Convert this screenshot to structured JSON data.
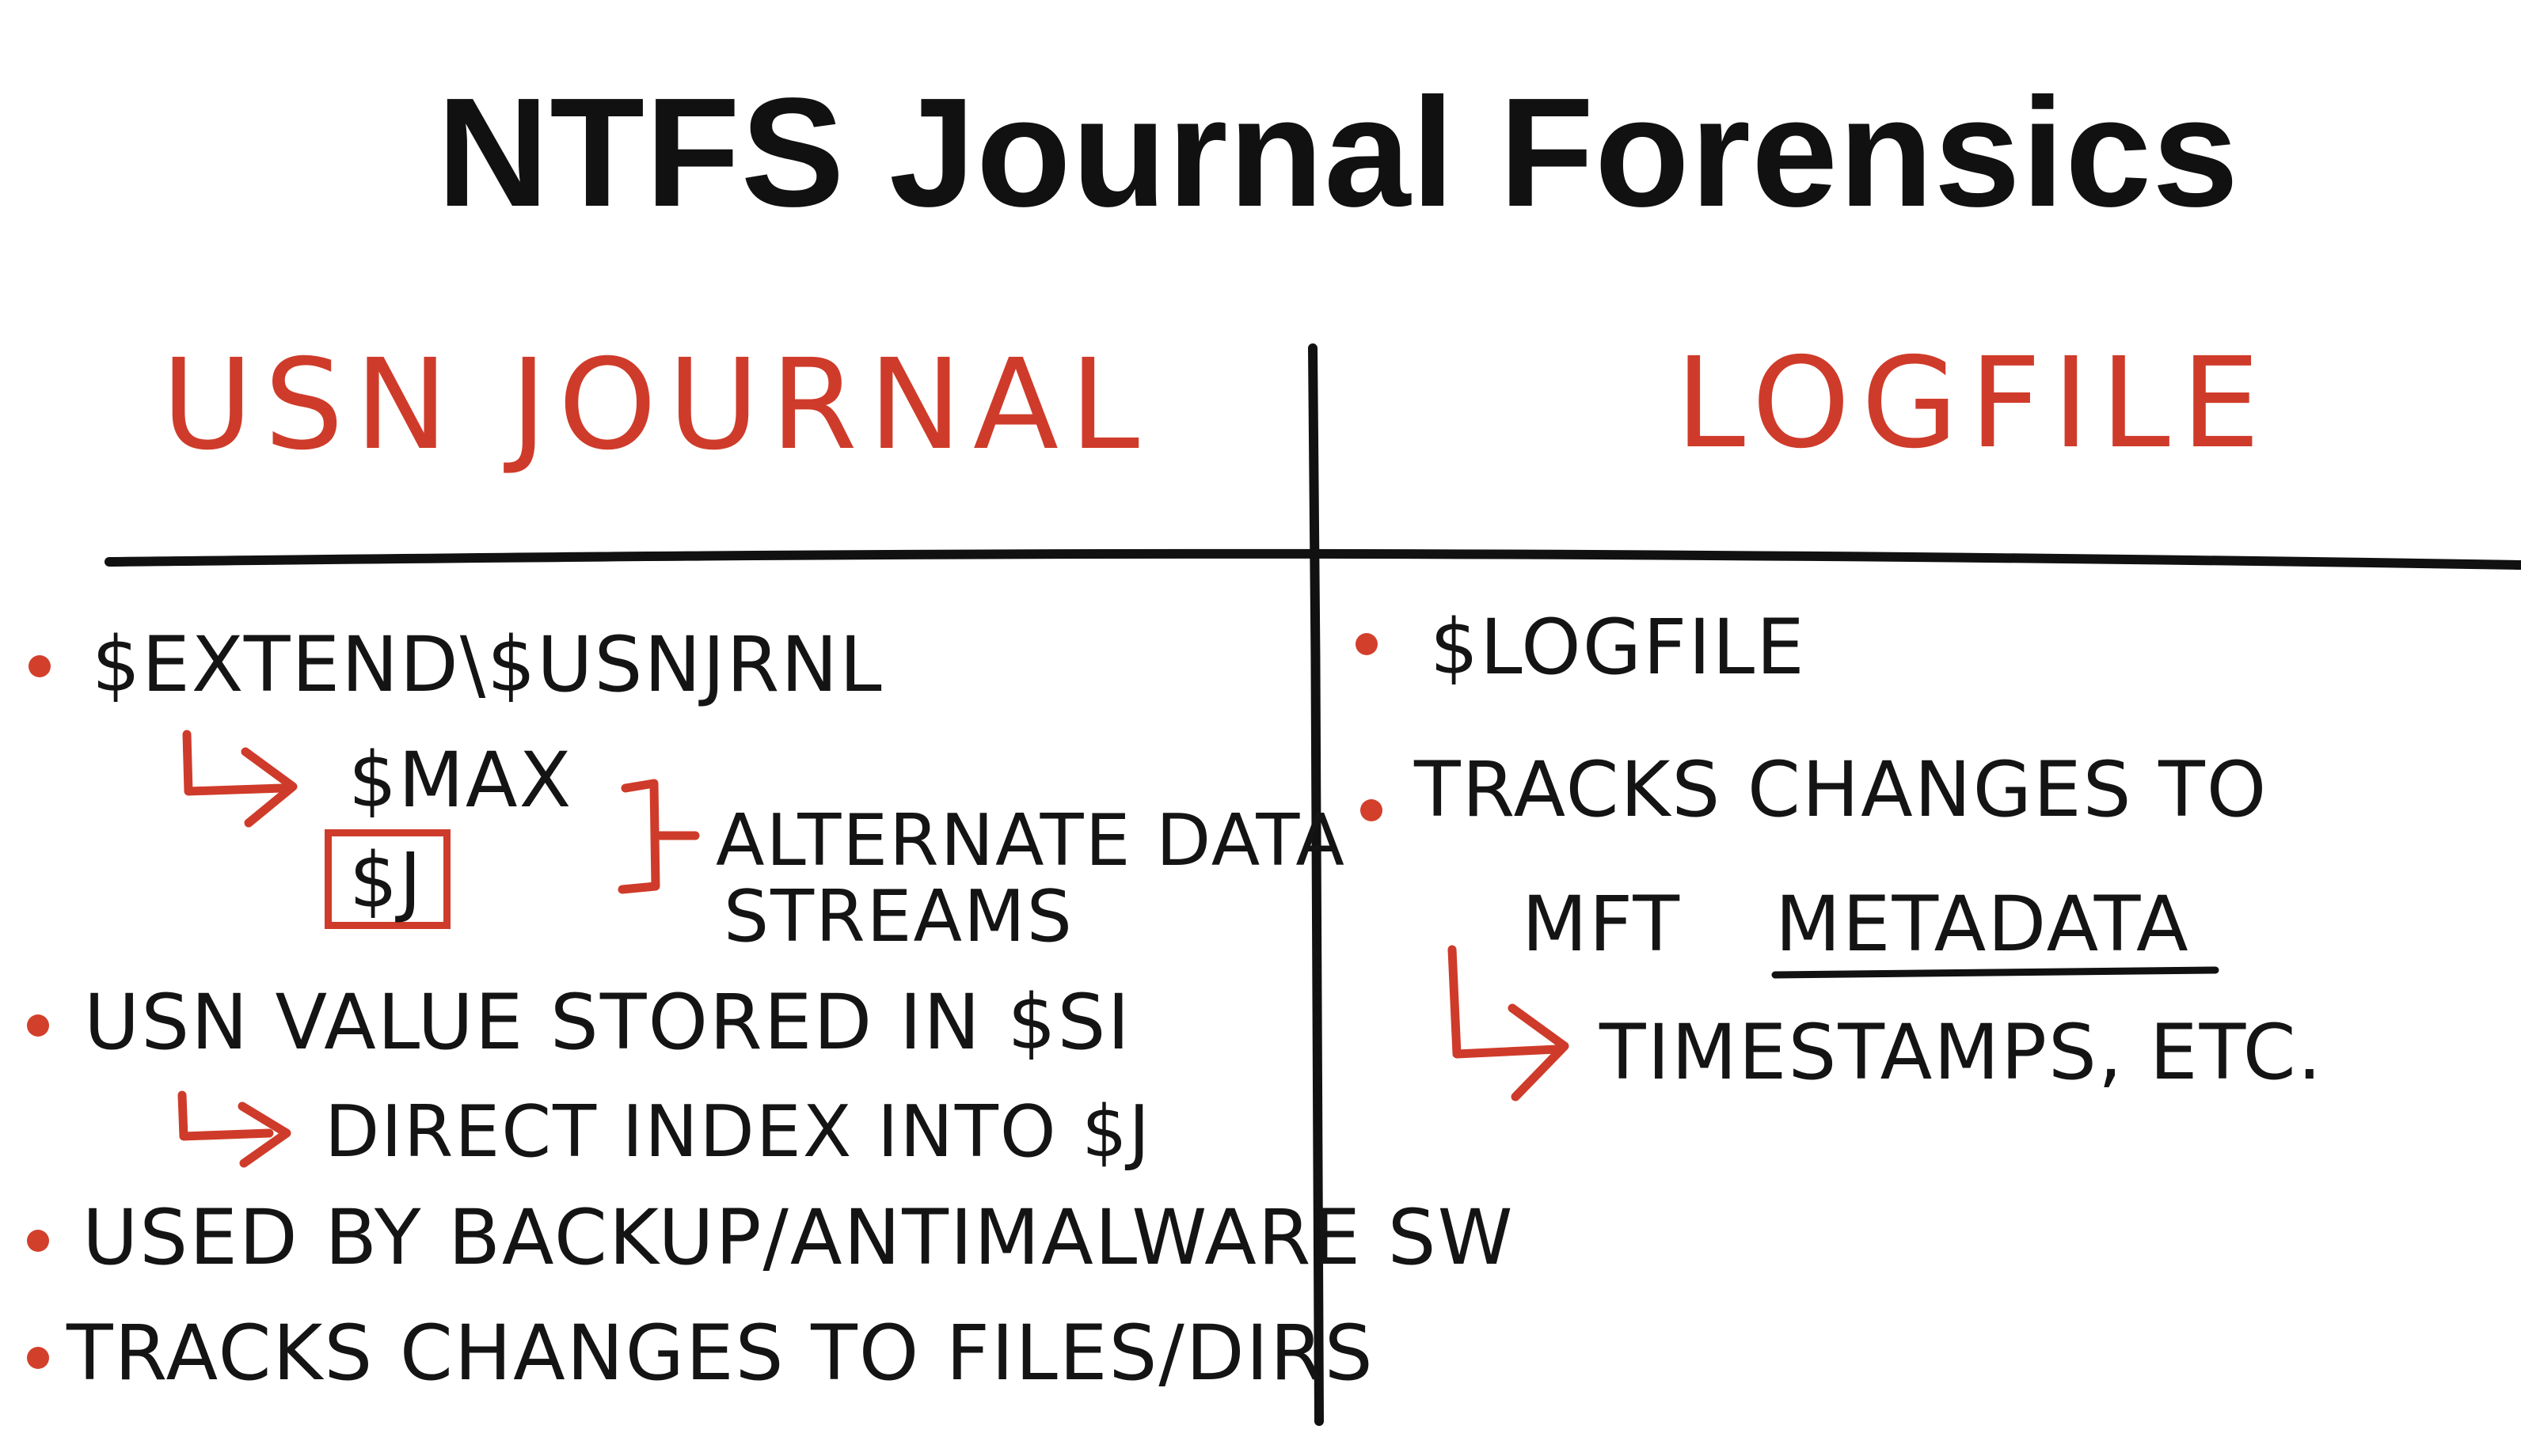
{
  "title": "NTFS Journal Forensics",
  "left": {
    "heading": "USN JOURNAL",
    "items": [
      "$EXTEND\\$USNJRNL",
      "$MAX",
      "$J",
      "ALTERNATE DATA",
      "STREAMS",
      "USN VALUE STORED IN $SI",
      "DIRECT INDEX INTO $J",
      "USED BY BACKUP/ANTIMALWARE SW",
      "TRACKS CHANGES TO FILES/DIRS"
    ]
  },
  "right": {
    "heading": "LOGFILE",
    "items": [
      "$LOGFILE",
      "TRACKS CHANGES TO",
      "MFT",
      "METADATA",
      "TIMESTAMPS, ETC."
    ]
  },
  "colors": {
    "ink": "#141414",
    "accent": "#cf3b2a"
  }
}
